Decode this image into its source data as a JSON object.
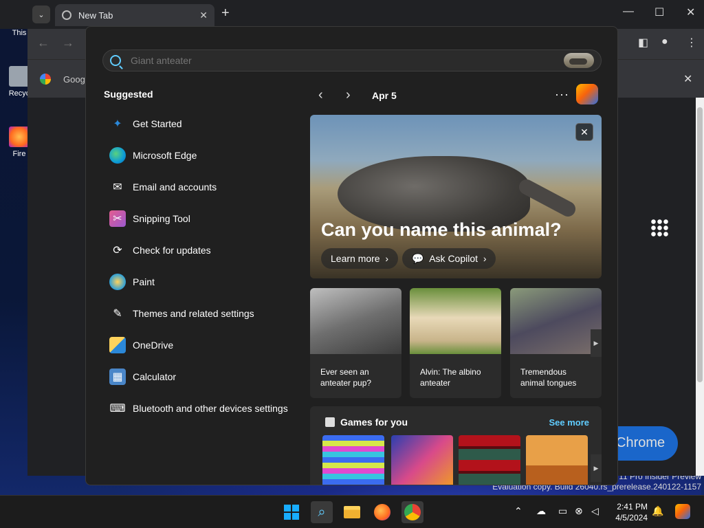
{
  "desktop": {
    "icons": [
      {
        "label": "This",
        "name": "this-pc-icon"
      },
      {
        "label": "Recyc",
        "name": "recycle-bin-icon"
      },
      {
        "label": "Fire",
        "name": "firefox-icon"
      }
    ],
    "watermark_line1": "11 Pro Insider Preview",
    "watermark_line2": "Evaluation copy. Build 26040.rs_prerelease.240122-1157"
  },
  "chrome": {
    "tab_title": "New Tab",
    "bookmark_label": "Goog",
    "chrome_pill_text": "Chrome"
  },
  "search": {
    "value": "",
    "placeholder": "Giant anteater"
  },
  "suggested": {
    "title": "Suggested",
    "items": [
      {
        "label": "Get Started",
        "icon": "get-started-icon",
        "color": "#2b88d8"
      },
      {
        "label": "Microsoft Edge",
        "icon": "edge-icon",
        "color": "#0c9bd7"
      },
      {
        "label": "Email and accounts",
        "icon": "mail-icon",
        "color": "#ffffff"
      },
      {
        "label": "Snipping Tool",
        "icon": "snipping-tool-icon",
        "color": "#e35c8f"
      },
      {
        "label": "Check for updates",
        "icon": "refresh-icon",
        "color": "#ffffff"
      },
      {
        "label": "Paint",
        "icon": "paint-icon",
        "color": "#2b9fd8"
      },
      {
        "label": "Themes and related settings",
        "icon": "brush-icon",
        "color": "#ffffff"
      },
      {
        "label": "OneDrive",
        "icon": "onedrive-icon",
        "color": "#ffd35c"
      },
      {
        "label": "Calculator",
        "icon": "calculator-icon",
        "color": "#4a86c8"
      },
      {
        "label": "Bluetooth and other devices settings",
        "icon": "devices-icon",
        "color": "#ffffff"
      }
    ]
  },
  "daily": {
    "date": "Apr 5",
    "hero_title": "Can you name this animal?",
    "learn_more": "Learn more",
    "ask_copilot": "Ask Copilot",
    "cards": [
      {
        "caption": "Ever seen an anteater pup?"
      },
      {
        "caption": "Alvin: The albino anteater"
      },
      {
        "caption": "Tremendous animal tongues"
      }
    ]
  },
  "games": {
    "title": "Games for you",
    "see_more": "See more"
  },
  "taskbar": {
    "time": "2:41 PM",
    "date": "4/5/2024"
  },
  "colors": {
    "accent": "#60cdff",
    "panel_bg": "#202020"
  }
}
